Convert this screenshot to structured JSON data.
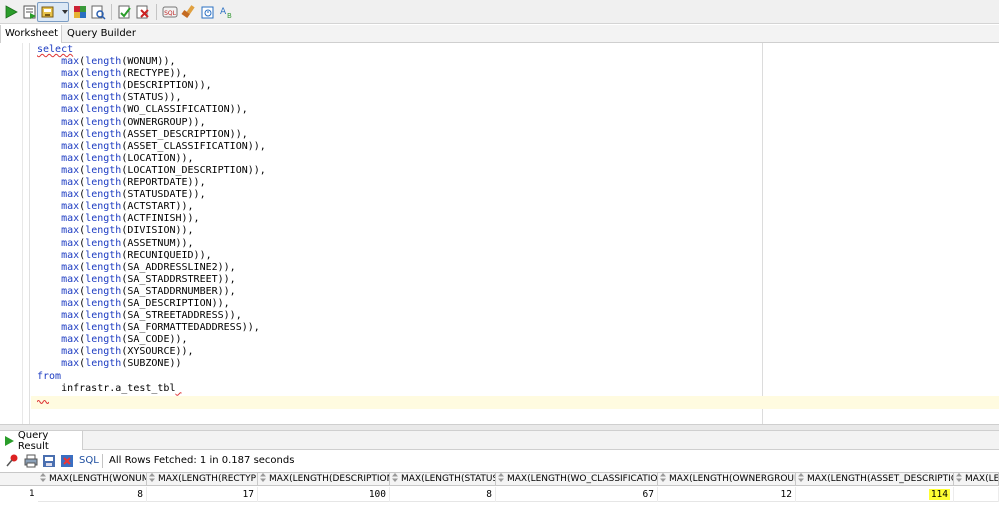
{
  "toolbar": {
    "buttons": [
      {
        "name": "run-statement-icon",
        "color": "#2a9d2a"
      },
      {
        "name": "run-script-icon"
      },
      {
        "name": "commit-icon"
      },
      {
        "name": "dropdown-arrow-icon"
      },
      {
        "name": "autotrace-icon"
      },
      {
        "name": "explain-plan-icon"
      },
      {
        "name": "sql-tuning-icon"
      },
      {
        "name": "rollback-icon"
      },
      {
        "name": "unshared-sql-icon"
      },
      {
        "name": "clear-icon"
      },
      {
        "name": "sql-history-icon"
      },
      {
        "name": "find-replace-icon"
      }
    ]
  },
  "tabs": {
    "worksheet": "Worksheet",
    "query_builder": "Query Builder"
  },
  "editor": {
    "lines": [
      {
        "kw": "select",
        "text": ""
      },
      {
        "text": "    max(length(WONUM)),"
      },
      {
        "text": "    max(length(RECTYPE)),"
      },
      {
        "text": "    max(length(DESCRIPTION)),"
      },
      {
        "text": "    max(length(STATUS)),"
      },
      {
        "text": "    max(length(WO_CLASSIFICATION)),"
      },
      {
        "text": "    max(length(OWNERGROUP)),"
      },
      {
        "text": "    max(length(ASSET_DESCRIPTION)),"
      },
      {
        "text": "    max(length(ASSET_CLASSIFICATION)),"
      },
      {
        "text": "    max(length(LOCATION)),"
      },
      {
        "text": "    max(length(LOCATION_DESCRIPTION)),"
      },
      {
        "text": "    max(length(REPORTDATE)),"
      },
      {
        "text": "    max(length(STATUSDATE)),"
      },
      {
        "text": "    max(length(ACTSTART)),"
      },
      {
        "text": "    max(length(ACTFINISH)),"
      },
      {
        "text": "    max(length(DIVISION)),"
      },
      {
        "text": "    max(length(ASSETNUM)),"
      },
      {
        "text": "    max(length(RECUNIQUEID)),"
      },
      {
        "text": "    max(length(SA_ADDRESSLINE2)),"
      },
      {
        "text": "    max(length(SA_STADDRSTREET)),"
      },
      {
        "text": "    max(length(SA_STADDRNUMBER)),"
      },
      {
        "text": "    max(length(SA_DESCRIPTION)),"
      },
      {
        "text": "    max(length(SA_STREETADDRESS)),"
      },
      {
        "text": "    max(length(SA_FORMATTEDADDRESS)),"
      },
      {
        "text": "    max(length(SA_CODE)),"
      },
      {
        "text": "    max(length(XYSOURCE)),"
      },
      {
        "text": "    max(length(SUBZONE))"
      },
      {
        "kw": "from",
        "text": ""
      },
      {
        "text": "    infrastr.a_test_tbl"
      }
    ]
  },
  "results": {
    "tab_label": "Query Result",
    "sql_link": "SQL",
    "status": "All Rows Fetched: 1 in 0.187 seconds",
    "columns": [
      "MAX(LENGTH(WONUM))",
      "MAX(LENGTH(RECTYPE))",
      "MAX(LENGTH(DESCRIPTION))",
      "MAX(LENGTH(STATUS))",
      "MAX(LENGTH(WO_CLASSIFICATION))",
      "MAX(LENGTH(OWNERGROUP))",
      "MAX(LENGTH(ASSET_DESCRIPTION))",
      "MAX(LEN"
    ],
    "row_number": "1",
    "values": [
      "8",
      "17",
      "100",
      "8",
      "67",
      "12",
      "114",
      ""
    ],
    "highlight_color": "#ffff33"
  }
}
